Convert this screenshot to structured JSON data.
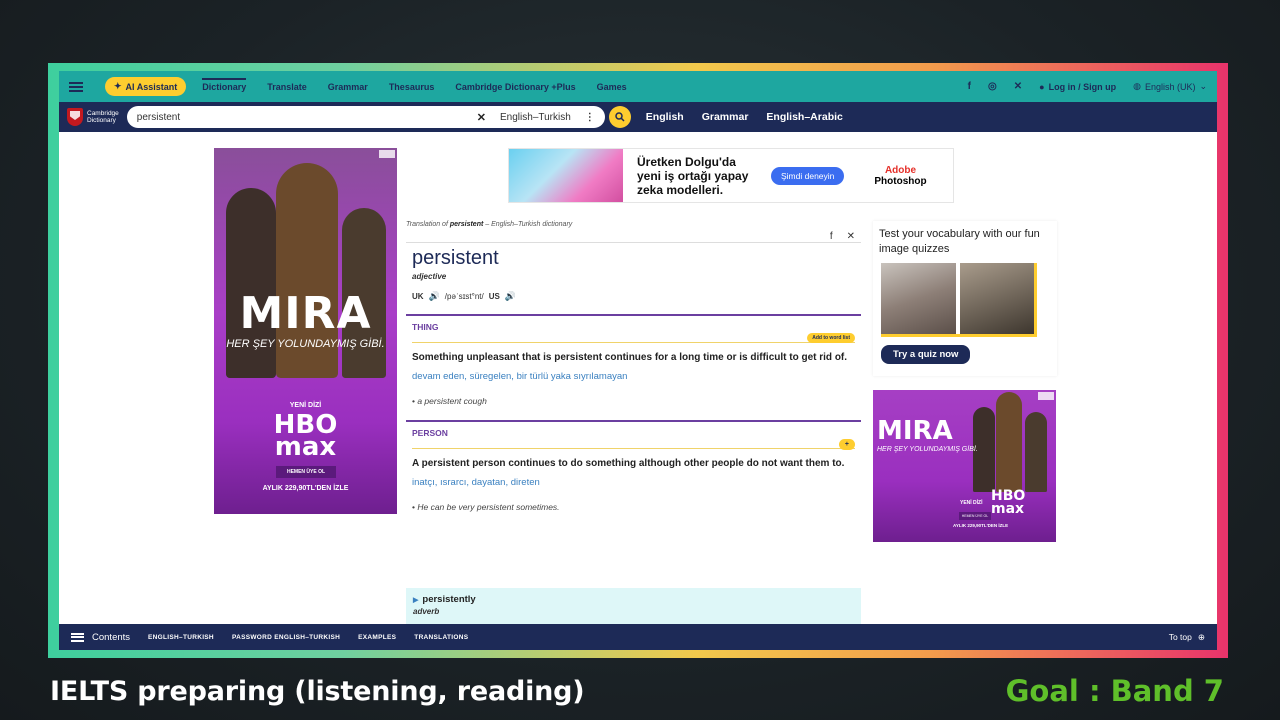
{
  "nav": {
    "ai_label": "AI Assistant",
    "links": [
      "Dictionary",
      "Translate",
      "Grammar",
      "Thesaurus",
      "Cambridge Dictionary +Plus",
      "Games"
    ],
    "login": "Log in / Sign up",
    "language": "English (UK)"
  },
  "logo": {
    "line1": "Cambridge",
    "line2": "Dictionary"
  },
  "search": {
    "value": "persistent",
    "dictionary": "English–Turkish",
    "quick_links": [
      "English",
      "Grammar",
      "English–Arabic"
    ]
  },
  "banner_ad": {
    "text": "Üretken Dolgu'da yeni iş ortağı yapay zeka modelleri.",
    "button": "Şimdi deneyin",
    "brand1": "Adobe",
    "brand2": "Photoshop"
  },
  "left_ad": {
    "title": "MIRA",
    "subtitle": "HER ŞEY YOLUNDAYMIŞ GİBİ.",
    "tag": "YENİ DİZİ",
    "brand1": "HBO",
    "brand2": "max",
    "button": "HEMEN ÜYE OL",
    "price": "AYLIK 229,90TL'DEN İZLE"
  },
  "entry": {
    "crumb_prefix": "Translation of ",
    "crumb_word": "persistent",
    "crumb_suffix": " – English–Turkish dictionary",
    "headword": "persistent",
    "pos": "adjective",
    "uk": "UK",
    "ipa": "/pəˈsɪst°nt/",
    "us": "US",
    "senses": [
      {
        "guide": "THING",
        "wordlist": "Add to word list",
        "definition": "Something unpleasant that is persistent continues for a long time or is difficult to get rid of.",
        "translation": "devam eden, süregelen, bir türlü yaka sıyrılamayan",
        "example": "a persistent cough"
      },
      {
        "guide": "PERSON",
        "wordlist": "+",
        "definition": "A persistent person continues to do something although other people do not want them to.",
        "translation": "inatçı, ısrarcı, dayatan, direten",
        "example": "He can be very persistent sometimes."
      }
    ],
    "derived_word": "persistently",
    "derived_pos": "adverb"
  },
  "quiz": {
    "title": "Test your vocabulary with our fun image quizzes",
    "button": "Try a quiz now"
  },
  "right_ad": {
    "title": "MIRA",
    "subtitle": "HER ŞEY YOLUNDAYMIŞ GİBİ.",
    "tag": "YENİ DİZİ",
    "brand1": "HBO",
    "brand2": "max",
    "button": "HEMEN ÜYE OL",
    "price": "AYLIK 229,90TL'DEN İZLE"
  },
  "bottom": {
    "contents": "Contents",
    "links": [
      "ENGLISH–TURKISH",
      "PASSWORD ENGLISH–TURKISH",
      "EXAMPLES",
      "TRANSLATIONS"
    ],
    "to_top": "To top"
  },
  "captions": {
    "left": "IELTS preparing (listening, reading)",
    "right": "Goal : Band 7"
  },
  "colors": {
    "nav_teal": "#1ea7a0",
    "navy": "#1d2a57",
    "yellow": "#fecd2f",
    "purple": "#6b3fa0",
    "goal_green": "#5fbf2a"
  }
}
